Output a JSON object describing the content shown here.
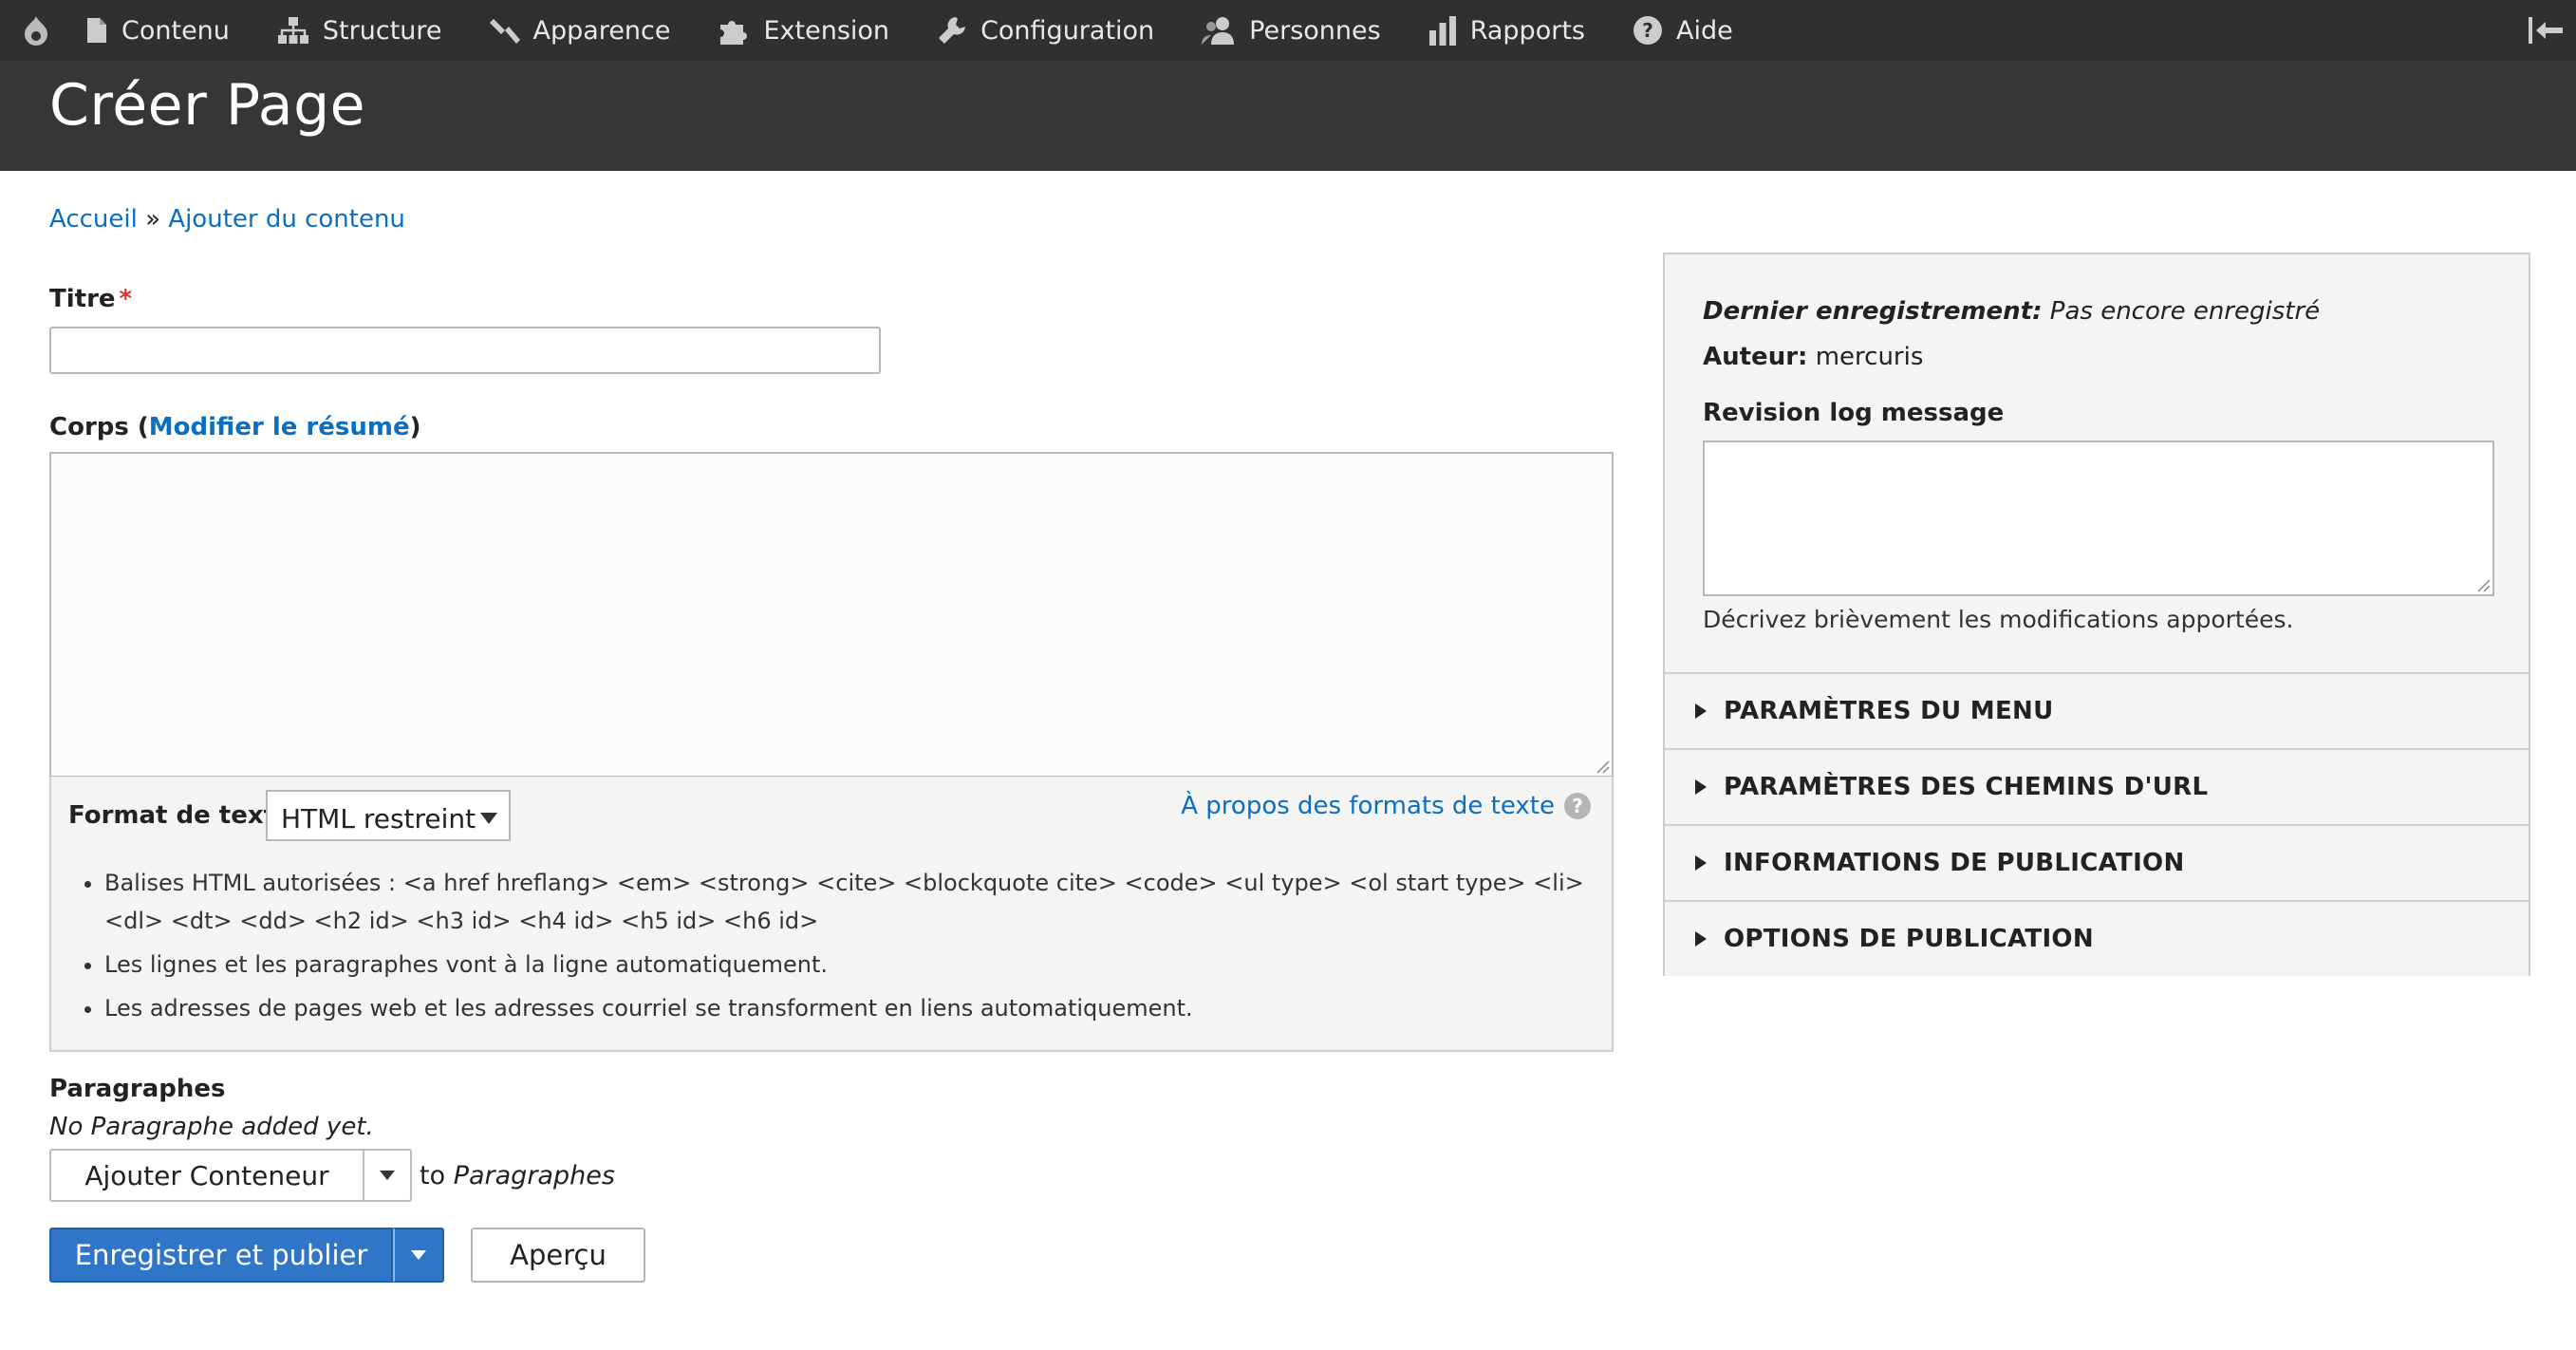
{
  "toolbar": {
    "items": [
      {
        "label": "Contenu",
        "icon": "file-icon"
      },
      {
        "label": "Structure",
        "icon": "sitemap-icon"
      },
      {
        "label": "Apparence",
        "icon": "brush-icon"
      },
      {
        "label": "Extension",
        "icon": "puzzle-icon"
      },
      {
        "label": "Configuration",
        "icon": "wrench-icon"
      },
      {
        "label": "Personnes",
        "icon": "people-icon"
      },
      {
        "label": "Rapports",
        "icon": "bar-chart-icon"
      },
      {
        "label": "Aide",
        "icon": "help-icon"
      }
    ]
  },
  "header": {
    "title": "Créer Page"
  },
  "breadcrumb": {
    "home": "Accueil",
    "separator": "»",
    "current": "Ajouter du contenu"
  },
  "form": {
    "title_label": "Titre",
    "required_marker": "*",
    "title_value": "",
    "body_label_prefix": "Corps (",
    "body_summary_link": "Modifier le résumé",
    "body_label_suffix": ")",
    "format_label": "Format de texte",
    "format_selected": "HTML restreint",
    "format_help_link": "À propos des formats de texte",
    "format_help_icon": "?",
    "format_tips": [
      "Balises HTML autorisées : <a href hreflang> <em> <strong> <cite> <blockquote cite> <code> <ul type> <ol start type> <li> <dl> <dt> <dd> <h2 id> <h3 id> <h4 id> <h5 id> <h6 id>",
      "Les lignes et les paragraphes vont à la ligne automatiquement.",
      "Les adresses de pages web et les adresses courriel se transforment en liens automatiquement."
    ],
    "paragraphs_label": "Paragraphes",
    "paragraphs_empty": "No Paragraphe added yet.",
    "add_button": "Ajouter Conteneur",
    "add_to": "to",
    "add_to_target": "Paragraphes",
    "save_button": "Enregistrer et publier",
    "preview_button": "Aperçu"
  },
  "sidebar": {
    "last_saved_label": "Dernier enregistrement:",
    "last_saved_value": "Pas encore enregistré",
    "author_label": "Auteur:",
    "author_value": "mercuris",
    "revision_label": "Revision log message",
    "revision_value": "",
    "revision_help": "Décrivez brièvement les modifications apportées.",
    "sections": [
      "PARAMÈTRES DU MENU",
      "PARAMÈTRES DES CHEMINS D'URL",
      "INFORMATIONS DE PUBLICATION",
      "OPTIONS DE PUBLICATION"
    ]
  },
  "colors": {
    "accent": "#2f75c8",
    "link": "#0b6fc1",
    "toolbar": "#303030",
    "required": "#e0322b"
  }
}
